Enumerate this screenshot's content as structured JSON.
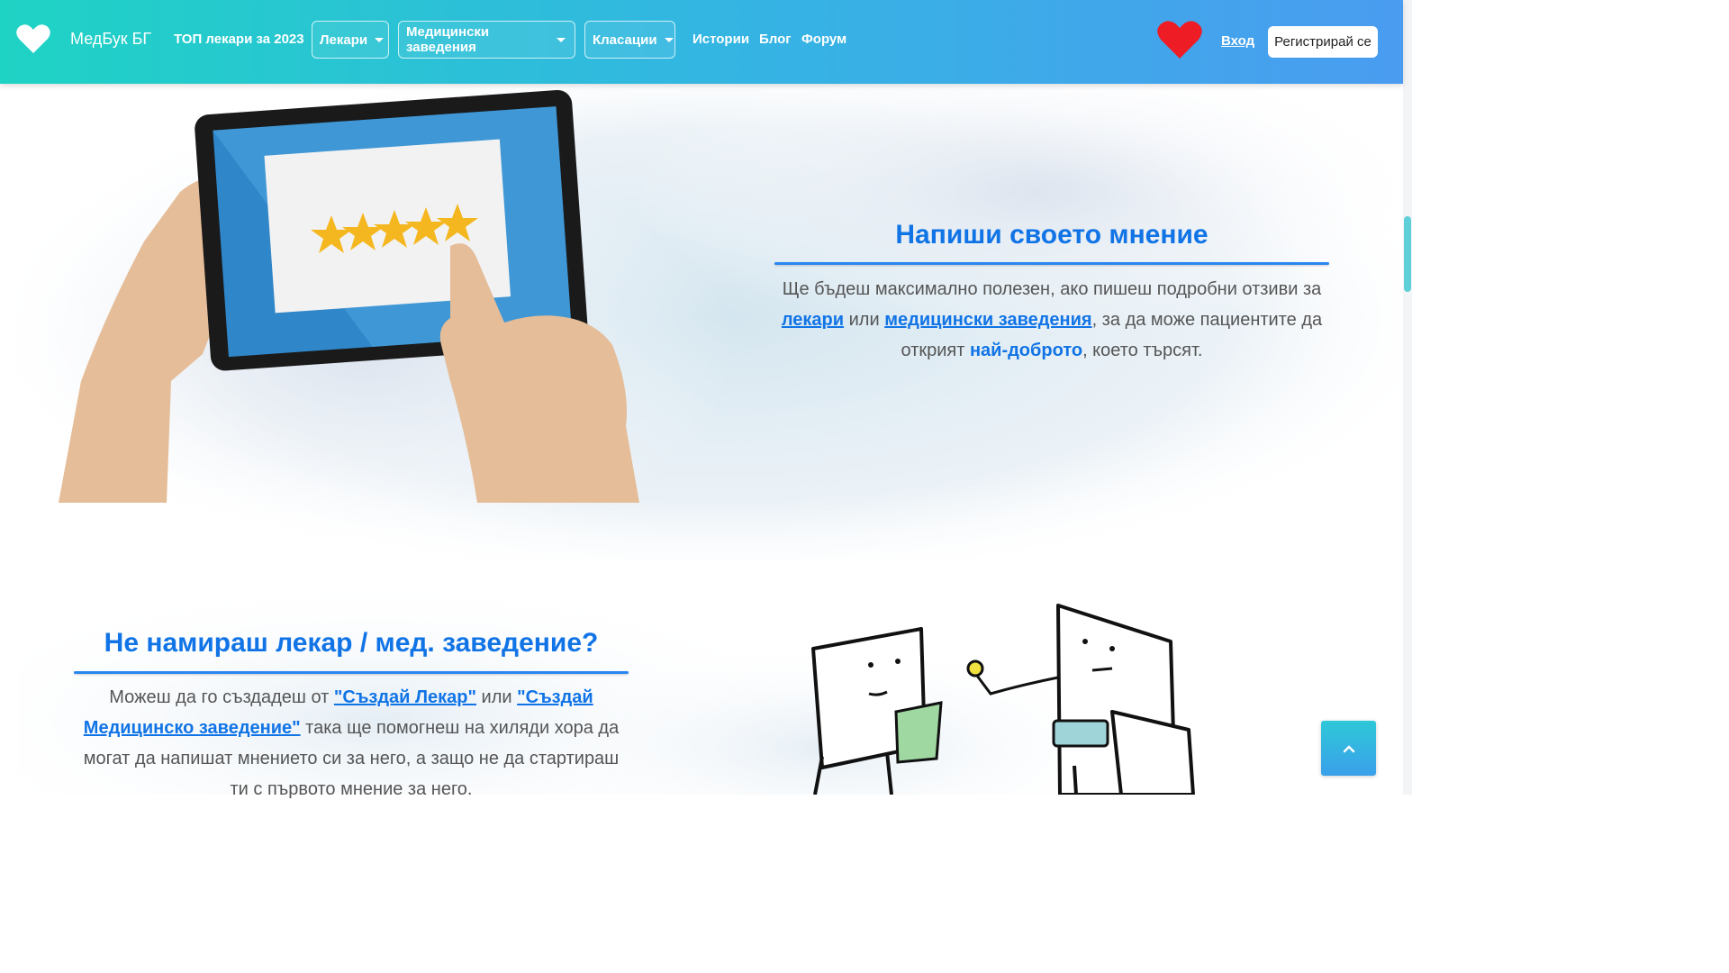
{
  "nav": {
    "brand": "МедБук БГ",
    "top_link": "ТОП лекари за 2023",
    "dropdowns": [
      "Лекари",
      "Медицински заведения",
      "Класации"
    ],
    "links": [
      "Истории",
      "Блог",
      "Форум"
    ],
    "login": "Вход",
    "register": "Регистрирай се"
  },
  "section_review": {
    "title": "Напиши своето мнение",
    "text_1": "Ще бъдеш максимално полезен, ако пишеш подробни отзиви за ",
    "link_doctors": "лекари",
    "text_2": " или ",
    "link_facilities": "медицински заведения",
    "text_3": ", за да може пациентите да открият ",
    "link_best": "най-доброто",
    "text_4": ", което търсят."
  },
  "section_create": {
    "title": "Не намираш лекар / мед. заведение?",
    "text_1": "Можеш да го създадеш от ",
    "link_create_doctor": "\"Създай Лекар\"",
    "text_2": " или ",
    "link_create_facility": "\"Създай Медицинско заведение\"",
    "text_3": " така ще помогнеш на хиляди хора да могат да напишат мнението си за него, а защо не да стартираш ти с първото мнение за него."
  },
  "icons": {
    "brand": "heart-icon",
    "favorites": "heart-icon",
    "back_to_top": "chevron-up-icon"
  },
  "colors": {
    "accent": "#1174e6",
    "nav_start": "#1fd3c4",
    "nav_end": "#4a9cf0",
    "heart": "#ee1c25"
  }
}
